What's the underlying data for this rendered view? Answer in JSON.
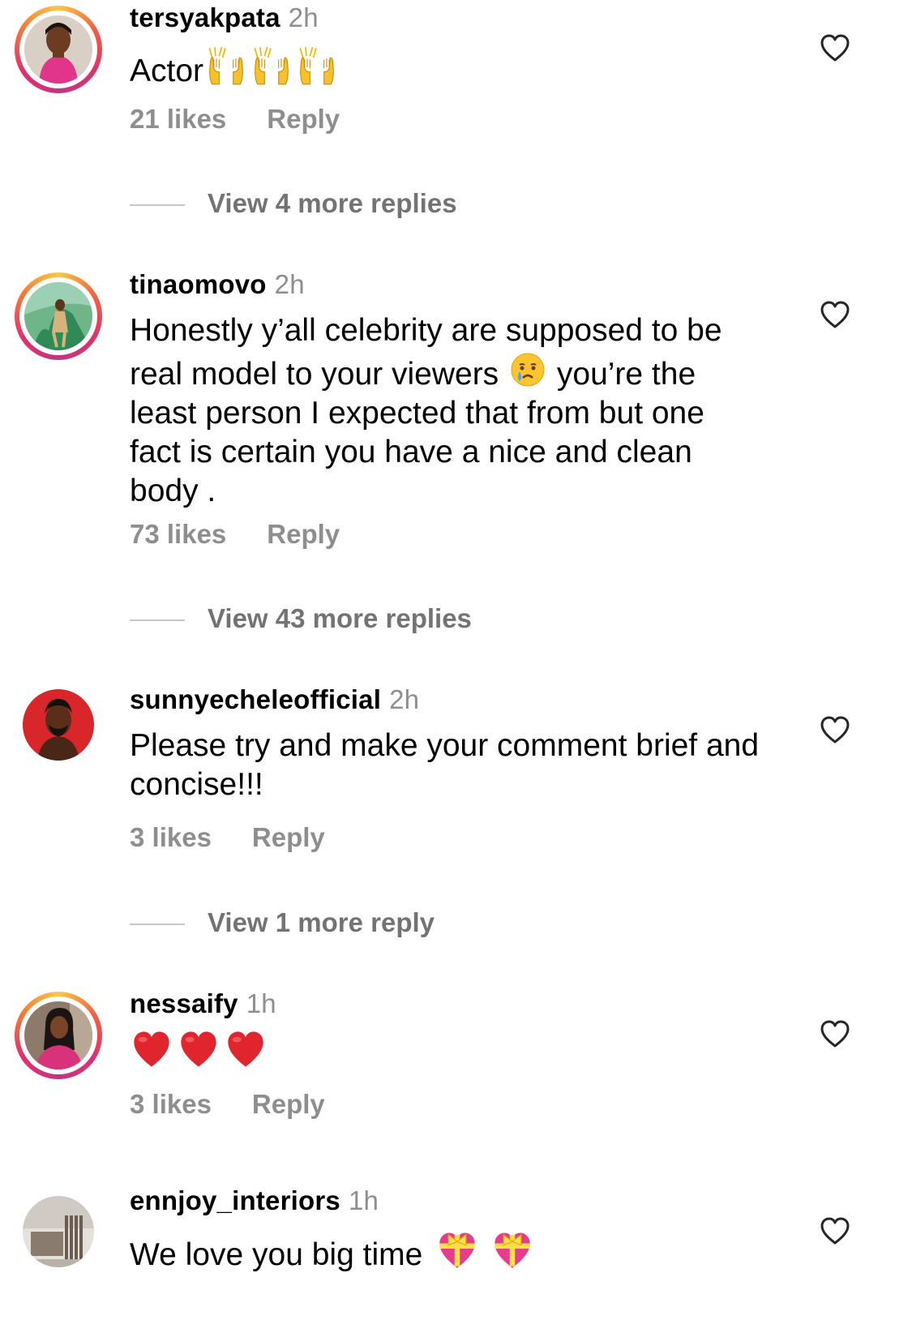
{
  "comments": [
    {
      "username": "tersyakpata",
      "time": "2h",
      "text": "Actor",
      "emoji_suffix": [
        "raising-hands",
        "raising-hands",
        "raising-hands"
      ],
      "likes": "21 likes",
      "reply_label": "Reply",
      "view_more": "View 4 more replies",
      "avatar": "avatar-pink-dress",
      "story_ring": true
    },
    {
      "username": "tinaomovo",
      "time": "2h",
      "text_before_emoji": "Honestly y’all celebrity are supposed to be real model to your viewers",
      "emoji_inline": "crying-face",
      "text_after_emoji": "you’re the least person I expected that from but one fact is certain you have a nice and clean body .",
      "likes": "73 likes",
      "reply_label": "Reply",
      "view_more": "View 43 more replies",
      "avatar": "avatar-outdoor-green",
      "story_ring": true
    },
    {
      "username": "sunnyecheleofficial",
      "time": "2h",
      "text": "Please try and make your comment brief and concise!!!",
      "likes": "3 likes",
      "reply_label": "Reply",
      "view_more": "View 1 more reply",
      "avatar": "avatar-red-background",
      "story_ring": false
    },
    {
      "username": "nessaify",
      "time": "1h",
      "emoji_only": [
        "red-heart",
        "red-heart",
        "red-heart"
      ],
      "likes": "3 likes",
      "reply_label": "Reply",
      "avatar": "avatar-pink-top",
      "story_ring": true
    },
    {
      "username": "ennjoy_interiors",
      "time": "1h",
      "text": "We love you big time",
      "emoji_suffix": [
        "heart-with-ribbon",
        "heart-with-ribbon"
      ],
      "avatar": "avatar-interior",
      "story_ring": false
    }
  ],
  "colors": {
    "secondary_text": "#8e8e8e",
    "divider": "#c7c7c7",
    "heart_red": "#e0252f"
  }
}
